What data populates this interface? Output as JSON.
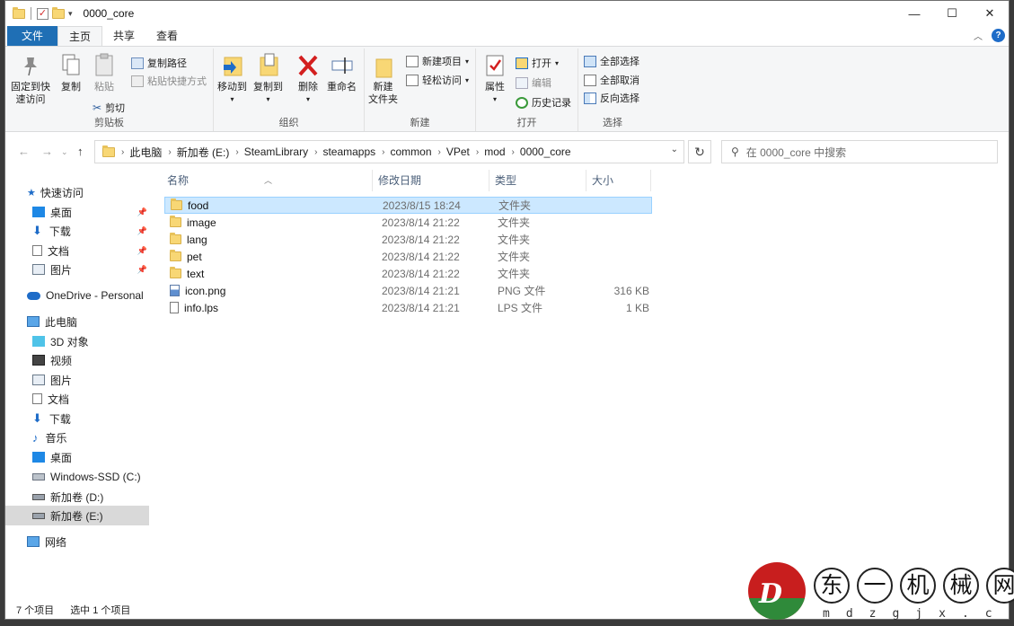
{
  "window": {
    "title": "0000_core",
    "controls": {
      "minimize": "—",
      "maximize": "☐",
      "close": "✕"
    }
  },
  "tabs": {
    "file": "文件",
    "home": "主页",
    "share": "共享",
    "view": "查看"
  },
  "ribbon": {
    "clipboard": {
      "label": "剪贴板",
      "pin_l1": "固定到快",
      "pin_l2": "速访问",
      "copy": "复制",
      "paste": "粘贴",
      "copy_path": "复制路径",
      "paste_shortcut": "粘贴快捷方式",
      "cut": "剪切"
    },
    "organize": {
      "label": "组织",
      "move_to": "移动到",
      "copy_to": "复制到",
      "delete": "删除",
      "rename": "重命名"
    },
    "new": {
      "label": "新建",
      "new_folder_l1": "新建",
      "new_folder_l2": "文件夹",
      "new_item": "新建项目",
      "easy_access": "轻松访问"
    },
    "open": {
      "label": "打开",
      "properties": "属性",
      "open": "打开",
      "edit": "编辑",
      "history": "历史记录"
    },
    "select": {
      "label": "选择",
      "select_all": "全部选择",
      "select_none": "全部取消",
      "invert": "反向选择"
    }
  },
  "address": {
    "crumbs": [
      "此电脑",
      "新加卷 (E:)",
      "SteamLibrary",
      "steamapps",
      "common",
      "VPet",
      "mod",
      "0000_core"
    ],
    "search_placeholder": "在 0000_core 中搜索"
  },
  "sidebar": {
    "items": [
      {
        "label": "快速访问",
        "icon": "star-icon"
      },
      {
        "label": "桌面",
        "icon": "desktop-icon"
      },
      {
        "label": "下载",
        "icon": "download-icon"
      },
      {
        "label": "文档",
        "icon": "document-icon"
      },
      {
        "label": "图片",
        "icon": "pictures-icon"
      },
      {
        "label": "OneDrive - Personal",
        "icon": "cloud-icon"
      },
      {
        "label": "此电脑",
        "icon": "computer-icon"
      },
      {
        "label": "3D 对象",
        "icon": "cube-icon"
      },
      {
        "label": "视频",
        "icon": "video-icon"
      },
      {
        "label": "图片",
        "icon": "pictures-icon"
      },
      {
        "label": "文档",
        "icon": "document-icon"
      },
      {
        "label": "下载",
        "icon": "download-icon"
      },
      {
        "label": "音乐",
        "icon": "music-icon"
      },
      {
        "label": "桌面",
        "icon": "desktop-icon"
      },
      {
        "label": "Windows-SSD (C:)",
        "icon": "drive-icon"
      },
      {
        "label": "新加卷 (D:)",
        "icon": "drive-icon"
      },
      {
        "label": "新加卷 (E:)",
        "icon": "drive-icon"
      },
      {
        "label": "网络",
        "icon": "network-icon"
      }
    ]
  },
  "columns": {
    "name": "名称",
    "date": "修改日期",
    "type": "类型",
    "size": "大小"
  },
  "files": [
    {
      "name": "food",
      "date": "2023/8/15 18:24",
      "type": "文件夹",
      "size": "",
      "icon": "folder-icon"
    },
    {
      "name": "image",
      "date": "2023/8/14 21:22",
      "type": "文件夹",
      "size": "",
      "icon": "folder-icon"
    },
    {
      "name": "lang",
      "date": "2023/8/14 21:22",
      "type": "文件夹",
      "size": "",
      "icon": "folder-icon"
    },
    {
      "name": "pet",
      "date": "2023/8/14 21:22",
      "type": "文件夹",
      "size": "",
      "icon": "folder-icon"
    },
    {
      "name": "text",
      "date": "2023/8/14 21:22",
      "type": "文件夹",
      "size": "",
      "icon": "folder-icon"
    },
    {
      "name": "icon.png",
      "date": "2023/8/14 21:21",
      "type": "PNG 文件",
      "size": "316 KB",
      "icon": "image-file-icon"
    },
    {
      "name": "info.lps",
      "date": "2023/8/14 21:21",
      "type": "LPS 文件",
      "size": "1 KB",
      "icon": "file-icon"
    }
  ],
  "status": {
    "count": "7 个项目",
    "selected": "选中 1 个项目"
  },
  "watermark": {
    "chars": [
      "东",
      "一",
      "机",
      "械",
      "网"
    ],
    "domain": "mdzgjx.c"
  },
  "colors": {
    "accent": "#1f6fb5",
    "selection": "#cce8ff",
    "selection_border": "#99d1ff",
    "folder": "#f8d775"
  }
}
